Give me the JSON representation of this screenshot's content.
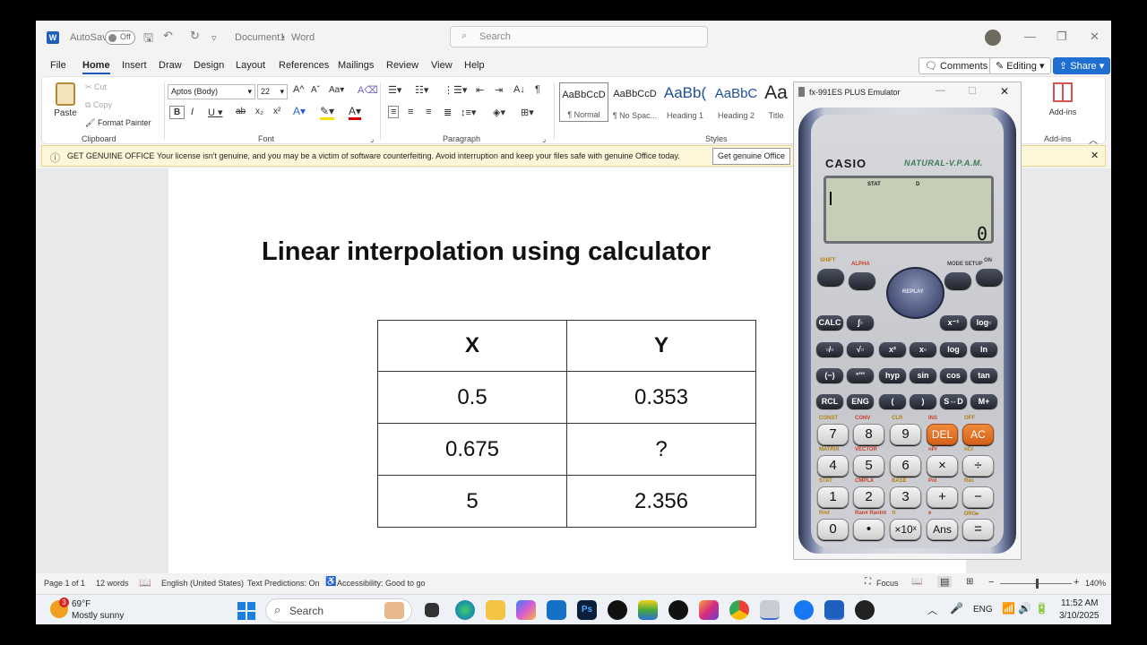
{
  "window": {
    "autosave_label": "AutoSave",
    "autosave_state": "Off",
    "doc_name": "Document1",
    "separator": "•",
    "app": "Word",
    "search_placeholder": "Search"
  },
  "menu": [
    "File",
    "Home",
    "Insert",
    "Draw",
    "Design",
    "Layout",
    "References",
    "Mailings",
    "Review",
    "View",
    "Help"
  ],
  "topbuttons": {
    "comments": "Comments",
    "editing": "Editing",
    "share": "Share"
  },
  "ribbon": {
    "paste": "Paste",
    "cut": "Cut",
    "copy": "Copy",
    "format_painter": "Format Painter",
    "font_name": "Aptos (Body)",
    "font_size": "22",
    "styles": [
      {
        "preview": "AaBbCcD",
        "name": "¶ Normal"
      },
      {
        "preview": "AaBbCcD",
        "name": "¶ No Spac..."
      },
      {
        "preview": "AaBb(",
        "name": "Heading 1"
      },
      {
        "preview": "AaBbC",
        "name": "Heading 2"
      },
      {
        "preview": "Aa",
        "name": "Title"
      }
    ],
    "addins": "Add-ins",
    "groups": {
      "clipboard": "Clipboard",
      "font": "Font",
      "paragraph": "Paragraph",
      "styles": "Styles",
      "addins": "Add-ins"
    }
  },
  "infobar": {
    "title": "GET GENUINE OFFICE",
    "message": "Your license isn't genuine, and you may be a victim of software counterfeiting. Avoid interruption and keep your files safe with genuine Office today.",
    "button": "Get genuine Office"
  },
  "document": {
    "title": "Linear interpolation using calculator",
    "table": [
      [
        "X",
        "Y"
      ],
      [
        "0.5",
        "0.353"
      ],
      [
        "0.675",
        "?"
      ],
      [
        "5",
        "2.356"
      ]
    ]
  },
  "statusbar": {
    "page": "Page 1 of 1",
    "words": "12 words",
    "language": "English (United States)",
    "predictions": "Text Predictions: On",
    "accessibility": "Accessibility: Good to go",
    "focus": "Focus",
    "zoom": "140%"
  },
  "calculator": {
    "title": "fx-991ES PLUS Emulator",
    "brand": "CASIO",
    "tagline": "NATURAL-V.P.A.M.",
    "indicator_stat": "STAT",
    "indicator_d": "D",
    "result": "0",
    "replay": "REPLAY",
    "top_labels": {
      "shift": "SHIFT",
      "alpha": "ALPHA",
      "mode": "MODE SETUP",
      "on": "ON"
    },
    "keys": {
      "r1": [
        "CALC",
        "∫▫",
        "",
        "",
        "x⁻¹",
        "log▫"
      ],
      "r2": [
        "▫/▫",
        "√▫",
        "x²",
        "x▫",
        "log",
        "ln"
      ],
      "r3": [
        "(−)",
        "°'''",
        "hyp",
        "sin",
        "cos",
        "tan"
      ],
      "r4": [
        "RCL",
        "ENG",
        "(",
        ")",
        "S⇔D",
        "M+"
      ],
      "r5": [
        "7",
        "8",
        "9",
        "DEL",
        "AC"
      ],
      "r6": [
        "4",
        "5",
        "6",
        "×",
        "÷"
      ],
      "r7": [
        "1",
        "2",
        "3",
        "+",
        "−"
      ],
      "r8": [
        "0",
        "•",
        "×10ˣ",
        "Ans",
        "="
      ]
    },
    "sub_labels": {
      "r5": [
        "CONST",
        "CONV",
        "CLR",
        "INS",
        "OFF"
      ],
      "r6": [
        "MATRIX",
        "VECTOR",
        "",
        "nPr",
        "nCr"
      ],
      "r7": [
        "STAT",
        "CMPLX",
        "BASE",
        "Pol",
        "Rec"
      ],
      "r8": [
        "Rnd",
        "Ran#  RanInt",
        "π",
        "e",
        "DRG▸"
      ]
    }
  },
  "taskbar": {
    "weather_badge": "3",
    "temp": "69°F",
    "weather": "Mostly sunny",
    "search": "Search",
    "lang": "ENG",
    "time": "11:52 AM",
    "date": "3/10/2025"
  },
  "colors": {
    "accent": "#185abd",
    "share": "#1f6fd1",
    "infobar": "#fdf6d8",
    "calc_orange": "#e0702a"
  }
}
